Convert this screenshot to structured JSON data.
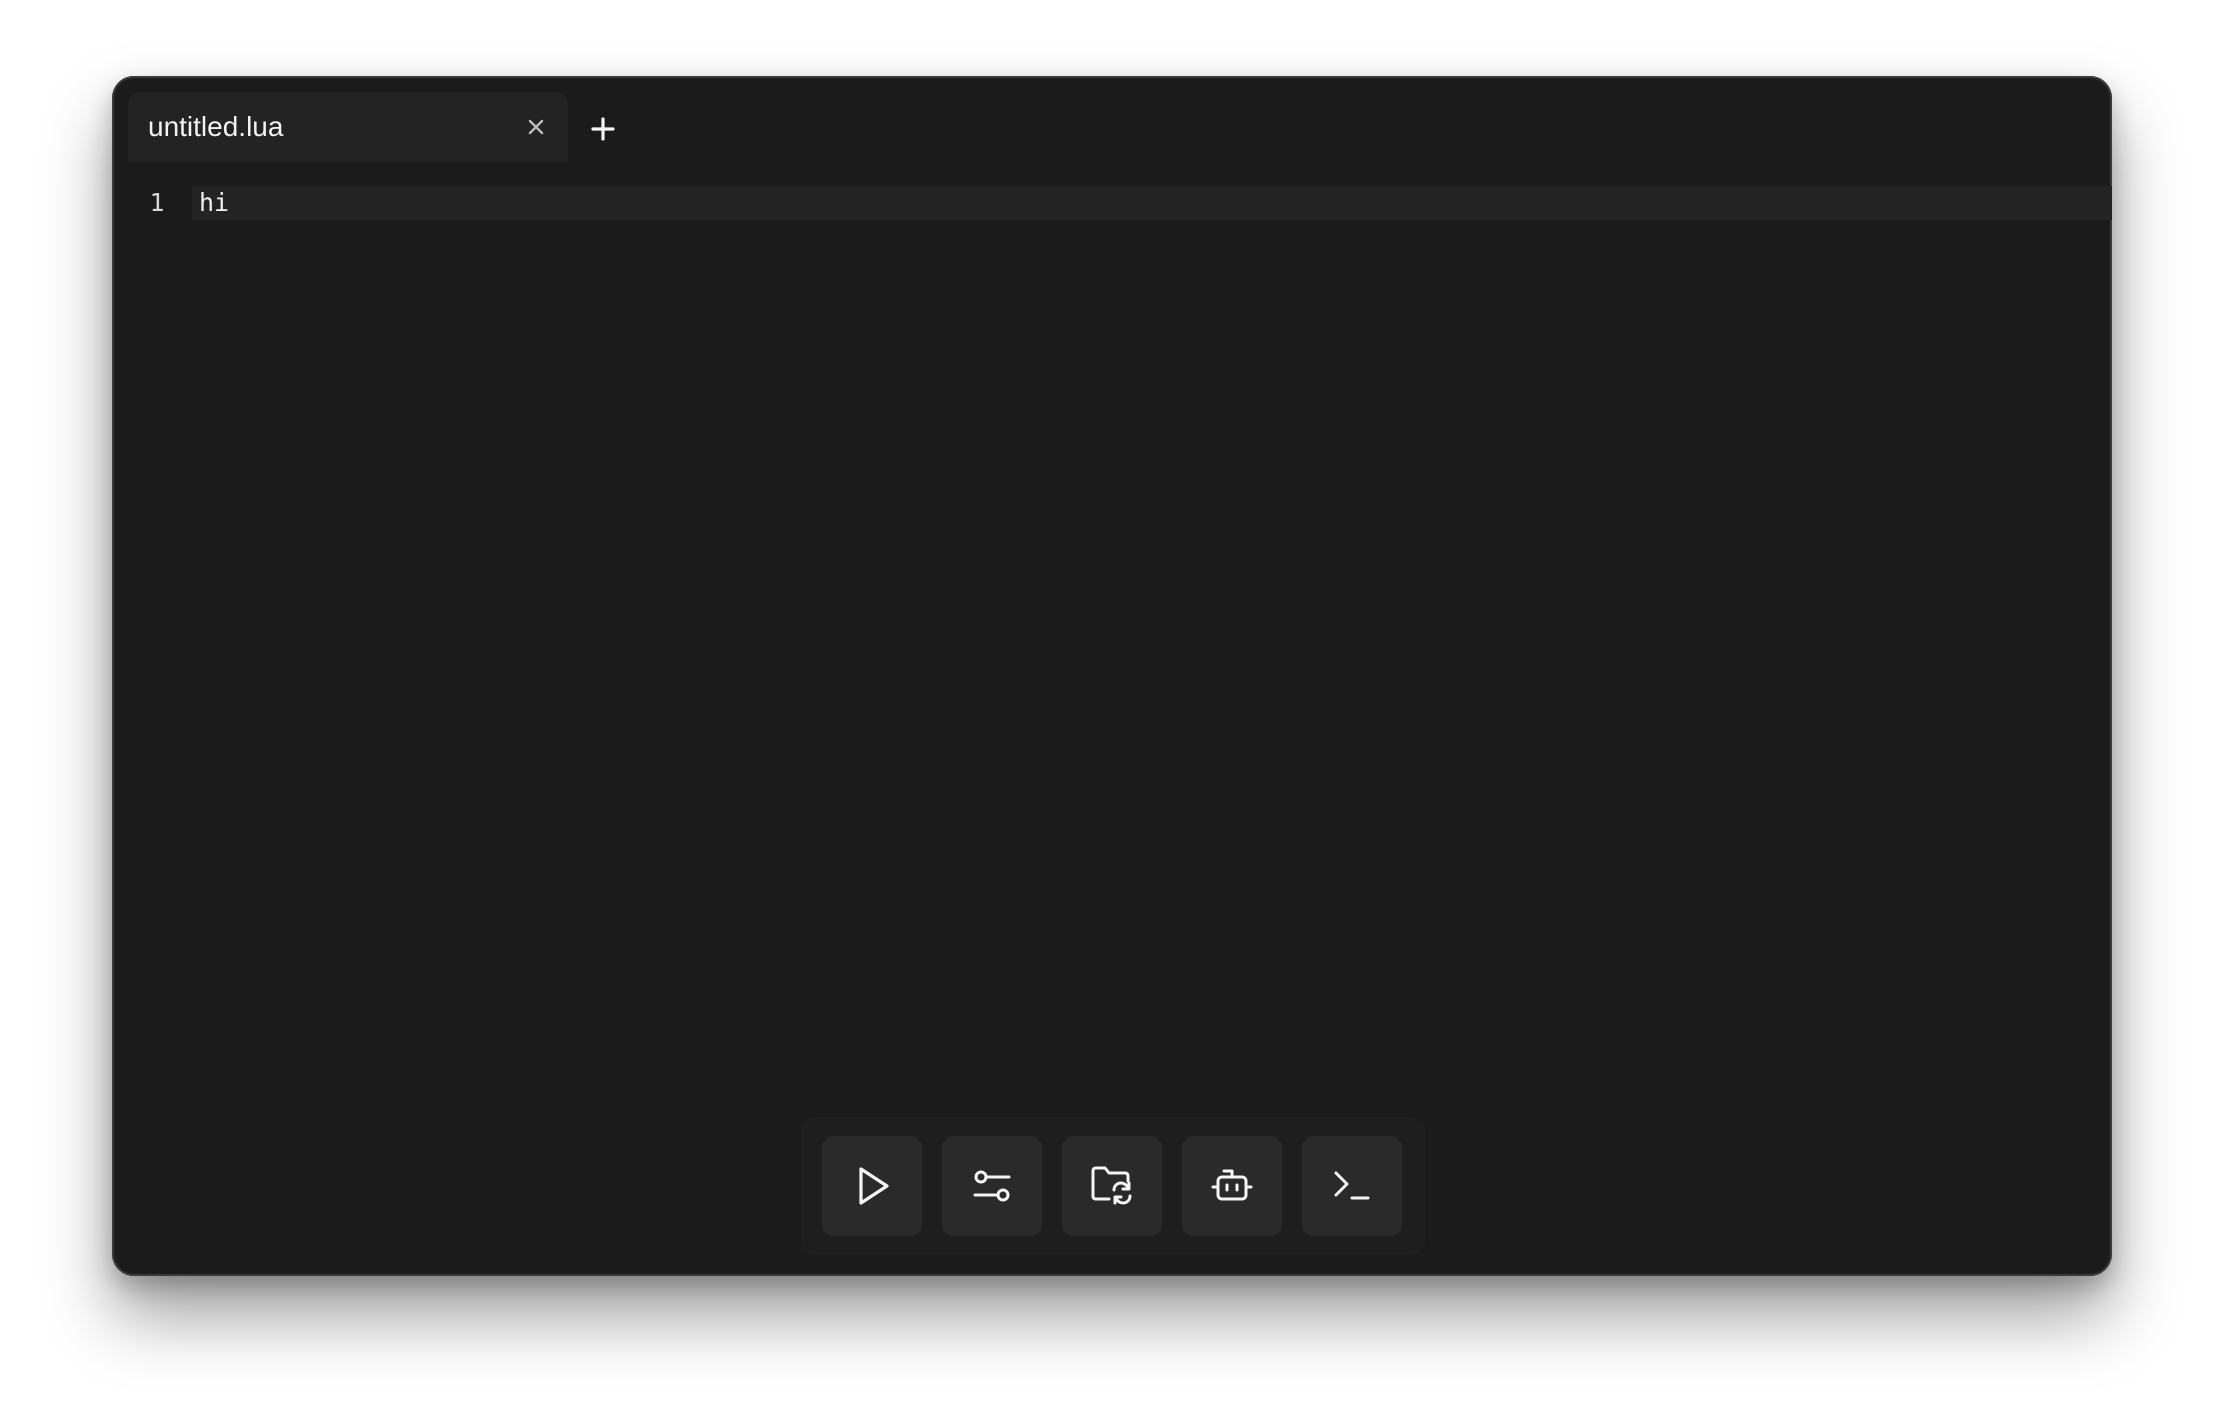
{
  "tabs": [
    {
      "label": "untitled.lua",
      "active": true
    }
  ],
  "editor": {
    "lines": [
      {
        "number": "1",
        "code": "hi"
      }
    ]
  },
  "toolbar": {
    "buttons": [
      {
        "name": "run",
        "icon": "play-icon"
      },
      {
        "name": "settings",
        "icon": "sliders-icon"
      },
      {
        "name": "folder-sync",
        "icon": "folder-sync-icon"
      },
      {
        "name": "assistant",
        "icon": "robot-icon"
      },
      {
        "name": "terminal",
        "icon": "terminal-icon"
      }
    ]
  },
  "colors": {
    "window_bg": "#1b1b1b",
    "tab_bg": "#232323",
    "button_bg": "#2a2a2a",
    "text": "#f2f2f2"
  }
}
